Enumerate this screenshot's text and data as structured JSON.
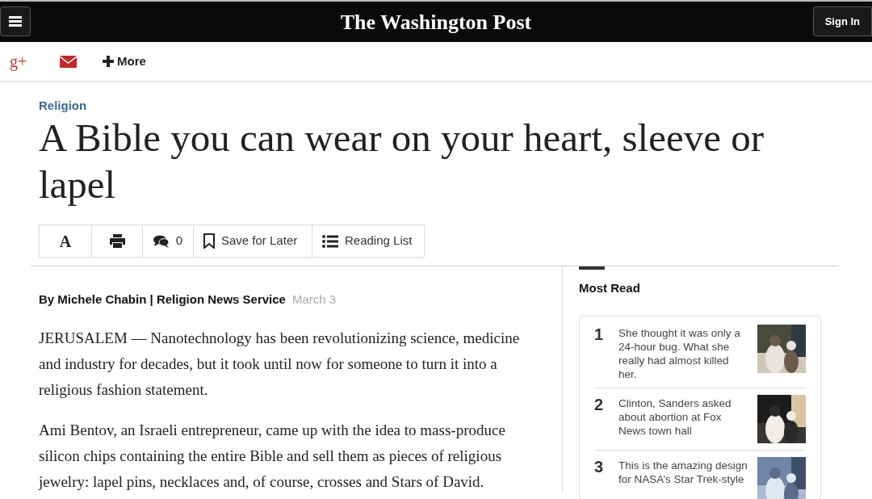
{
  "top_bar": {
    "logo": "The Washington Post",
    "sign_in": "Sign In"
  },
  "share_bar": {
    "google_plus": "g+",
    "more": "More"
  },
  "article": {
    "section": "Religion",
    "headline": "A Bible you can wear on your heart, sleeve or lapel",
    "toolbar": [
      {
        "kind": "font",
        "label": "A"
      },
      {
        "kind": "print"
      },
      {
        "kind": "comments",
        "label": "0"
      },
      {
        "kind": "save",
        "label": "Save for Later"
      },
      {
        "kind": "list",
        "label": "Reading List"
      }
    ],
    "byline": "By Michele Chabin | Religion News Service",
    "date": "March 3",
    "paragraphs": [
      "JERUSALEM — Nanotechnology has been revolutionizing science, medicine and industry for decades, but it took until now for someone to turn it into a religious fashion statement.",
      "Ami Bentov, an Israeli entrepreneur, came up with the idea to mass-produce silicon chips containing the entire Bible and sell them as pieces of religious jewelry: lapel pins, necklaces and, of course, crosses and Stars of David."
    ]
  },
  "most_read": {
    "title": "Most Read",
    "items": [
      {
        "number": "1",
        "headline": "She thought it was only a 24-hour bug. What she really had almost killed her."
      },
      {
        "number": "2",
        "headline": "Clinton, Sanders asked about abortion at Fox News town hall"
      },
      {
        "number": "3",
        "headline": "This is the amazing design for NASA’s Star Trek-style"
      }
    ]
  }
}
